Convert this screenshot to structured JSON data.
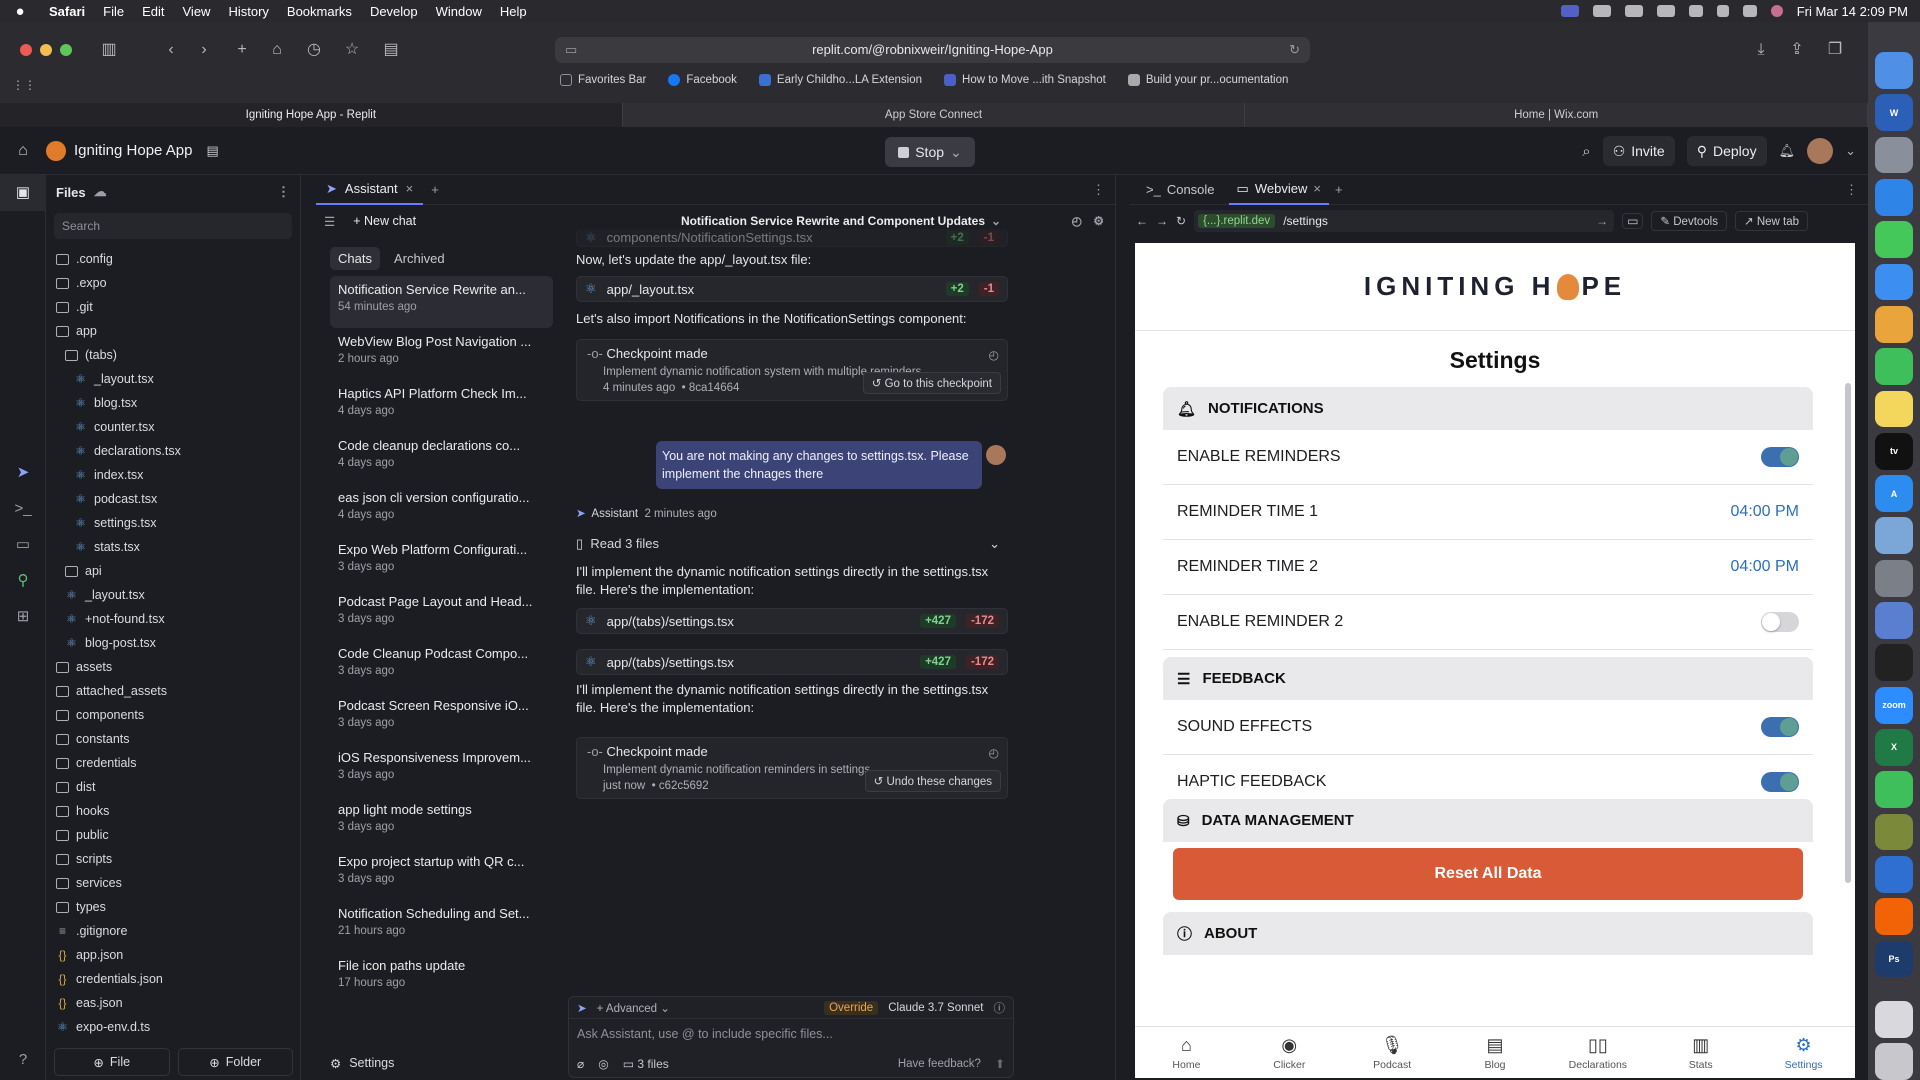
{
  "menubar": {
    "app": "Safari",
    "items": [
      "File",
      "Edit",
      "View",
      "History",
      "Bookmarks",
      "Develop",
      "Window",
      "Help"
    ],
    "datetime": "Fri Mar 14  2:09 PM"
  },
  "safari": {
    "url": "replit.com/@robnixweir/Igniting-Hope-App",
    "favorites": [
      {
        "label": "Favorites Bar",
        "color": "#8e909a"
      },
      {
        "label": "Facebook",
        "color": "#1877f2"
      },
      {
        "label": "Early Childho...LA Extension",
        "color": "#3b6fd1"
      },
      {
        "label": "How to Move ...ith Snapshot",
        "color": "#4b5fc7"
      },
      {
        "label": "Build your pr...ocumentation",
        "color": "#aaaaaa"
      }
    ],
    "tabs": [
      "Igniting Hope App - Replit",
      "App Store Connect",
      "Home | Wix.com"
    ]
  },
  "replit": {
    "app_name": "Igniting Hope App",
    "stop_label": "Stop",
    "invite_label": "Invite",
    "deploy_label": "Deploy"
  },
  "files": {
    "title": "Files",
    "search_placeholder": "Search",
    "items": [
      {
        "name": ".config",
        "type": "folder",
        "depth": 0
      },
      {
        "name": ".expo",
        "type": "folder",
        "depth": 0
      },
      {
        "name": ".git",
        "type": "folder",
        "depth": 0
      },
      {
        "name": "app",
        "type": "folder",
        "depth": 0
      },
      {
        "name": "(tabs)",
        "type": "folder",
        "depth": 1
      },
      {
        "name": "_layout.tsx",
        "type": "react",
        "depth": 2
      },
      {
        "name": "blog.tsx",
        "type": "react",
        "depth": 2
      },
      {
        "name": "counter.tsx",
        "type": "react",
        "depth": 2
      },
      {
        "name": "declarations.tsx",
        "type": "react",
        "depth": 2
      },
      {
        "name": "index.tsx",
        "type": "react",
        "depth": 2
      },
      {
        "name": "podcast.tsx",
        "type": "react",
        "depth": 2
      },
      {
        "name": "settings.tsx",
        "type": "react",
        "depth": 2
      },
      {
        "name": "stats.tsx",
        "type": "react",
        "depth": 2
      },
      {
        "name": "api",
        "type": "folder",
        "depth": 1
      },
      {
        "name": "_layout.tsx",
        "type": "react",
        "depth": 1
      },
      {
        "name": "+not-found.tsx",
        "type": "react",
        "depth": 1
      },
      {
        "name": "blog-post.tsx",
        "type": "react",
        "depth": 1
      },
      {
        "name": "assets",
        "type": "folder",
        "depth": 0
      },
      {
        "name": "attached_assets",
        "type": "folder",
        "depth": 0
      },
      {
        "name": "components",
        "type": "folder",
        "depth": 0
      },
      {
        "name": "constants",
        "type": "folder",
        "depth": 0
      },
      {
        "name": "credentials",
        "type": "folder",
        "depth": 0
      },
      {
        "name": "dist",
        "type": "folder",
        "depth": 0
      },
      {
        "name": "hooks",
        "type": "folder",
        "depth": 0
      },
      {
        "name": "public",
        "type": "folder",
        "depth": 0
      },
      {
        "name": "scripts",
        "type": "folder",
        "depth": 0
      },
      {
        "name": "services",
        "type": "folder",
        "depth": 0
      },
      {
        "name": "types",
        "type": "folder",
        "depth": 0
      },
      {
        "name": ".gitignore",
        "type": "text",
        "depth": 0
      },
      {
        "name": "app.json",
        "type": "json",
        "depth": 0
      },
      {
        "name": "credentials.json",
        "type": "json",
        "depth": 0
      },
      {
        "name": "eas.json",
        "type": "json",
        "depth": 0
      },
      {
        "name": "expo-env.d.ts",
        "type": "ts",
        "depth": 0
      }
    ],
    "new_file_label": "File",
    "new_folder_label": "Folder"
  },
  "assistant": {
    "tab_label": "Assistant",
    "new_chat_label": "New chat",
    "chats_tab": "Chats",
    "archived_tab": "Archived",
    "chats": [
      {
        "title": "Notification Service Rewrite an...",
        "time": "54 minutes ago"
      },
      {
        "title": "WebView Blog Post Navigation ...",
        "time": "2 hours ago"
      },
      {
        "title": "Haptics API Platform Check Im...",
        "time": "4 days ago"
      },
      {
        "title": "Code cleanup declarations co...",
        "time": "4 days ago"
      },
      {
        "title": "eas json cli version configuratio...",
        "time": "4 days ago"
      },
      {
        "title": "Expo Web Platform Configurati...",
        "time": "3 days ago"
      },
      {
        "title": "Podcast Page Layout and Head...",
        "time": "3 days ago"
      },
      {
        "title": "Code Cleanup Podcast Compo...",
        "time": "3 days ago"
      },
      {
        "title": "Podcast Screen Responsive iO...",
        "time": "3 days ago"
      },
      {
        "title": "iOS Responsiveness Improvem...",
        "time": "3 days ago"
      },
      {
        "title": "app light mode settings",
        "time": "3 days ago"
      },
      {
        "title": "Expo project startup with QR c...",
        "time": "3 days ago"
      },
      {
        "title": "Notification Scheduling and Set...",
        "time": "21 hours ago"
      },
      {
        "title": "File icon paths update",
        "time": "17 hours ago"
      }
    ],
    "settings_label": "Settings",
    "conversation_title": "Notification Service Rewrite and Component Updates",
    "faded_file": "components/NotificationSettings.tsx",
    "faded_add": "+2",
    "faded_del": "-1",
    "msg1": "Now, let's update the app/_layout.tsx file:",
    "file1": {
      "name": "app/_layout.tsx",
      "add": "+2",
      "del": "-1"
    },
    "msg2": "Let's also import Notifications in the NotificationSettings component:",
    "checkpoint1": {
      "title": "Checkpoint made",
      "desc": "Implement dynamic notification system with multiple reminders",
      "time": "4 minutes ago",
      "hash": "8ca14664",
      "button": "Go to this checkpoint"
    },
    "user_message": "You are not making any changes to settings.tsx. Please implement the chnages there",
    "assistant_name": "Assistant",
    "assistant_time": "2 minutes ago",
    "read_files": "Read 3 files",
    "msg3": "I'll implement the dynamic notification settings directly in the settings.tsx file. Here's the implementation:",
    "file2": {
      "name": "app/(tabs)/settings.tsx",
      "add": "+427",
      "del": "-172"
    },
    "file3": {
      "name": "app/(tabs)/settings.tsx",
      "add": "+427",
      "del": "-172"
    },
    "msg4": "I'll implement the dynamic notification settings directly in the settings.tsx file. Here's the implementation:",
    "checkpoint2": {
      "title": "Checkpoint made",
      "desc": "Implement dynamic notification reminders in settings",
      "time": "just now",
      "hash": "c62c5692",
      "button": "Undo these changes"
    },
    "composer": {
      "advanced": "Advanced",
      "override": "Override",
      "model": "Claude 3.7 Sonnet",
      "placeholder": "Ask Assistant, use @ to include specific files...",
      "files": "3 files",
      "feedback": "Have feedback?"
    }
  },
  "webview": {
    "console_tab": "Console",
    "webview_tab": "Webview",
    "domain": "{...}.replit.dev",
    "path": "/settings",
    "devtools": "Devtools",
    "new_tab": "New tab"
  },
  "app": {
    "brand_left": "IGNITING H",
    "brand_right": "PE",
    "title": "Settings",
    "notifications": {
      "header": "NOTIFICATIONS",
      "enable_reminders": "ENABLE REMINDERS",
      "enable_reminders_on": true,
      "reminder1_label": "REMINDER TIME 1",
      "reminder1_value": "04:00 PM",
      "reminder2_label": "REMINDER TIME 2",
      "reminder2_value": "04:00 PM",
      "enable_reminder2": "ENABLE REMINDER 2",
      "enable_reminder2_on": false
    },
    "feedback": {
      "header": "FEEDBACK",
      "sound": "SOUND EFFECTS",
      "sound_on": true,
      "haptic": "HAPTIC FEEDBACK",
      "haptic_on": true
    },
    "data": {
      "header": "DATA MANAGEMENT",
      "reset": "Reset All Data"
    },
    "about": {
      "header": "ABOUT"
    },
    "nav": [
      "Home",
      "Clicker",
      "Podcast",
      "Blog",
      "Declarations",
      "Stats",
      "Settings"
    ]
  }
}
